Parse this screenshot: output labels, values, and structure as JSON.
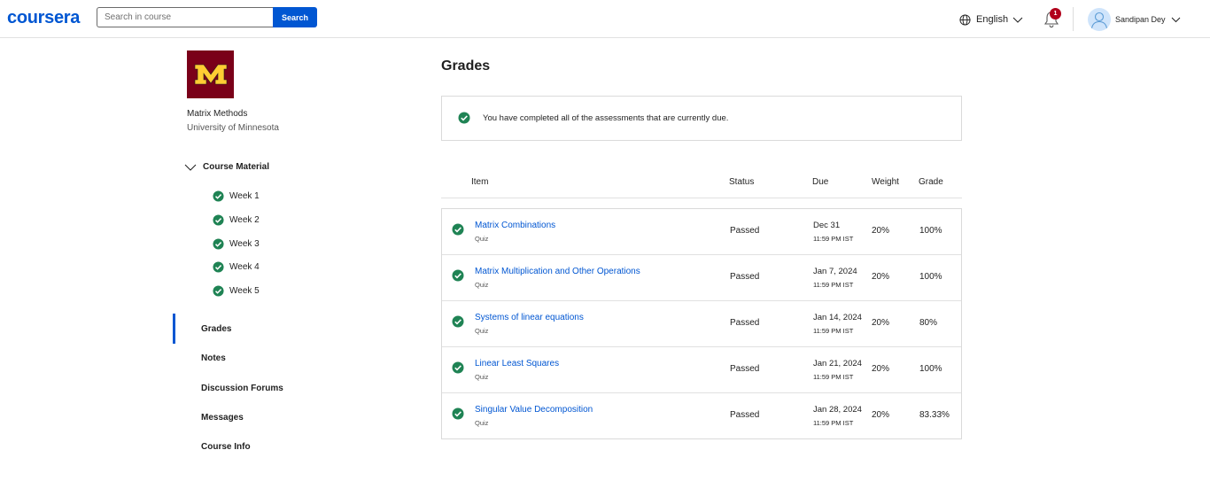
{
  "header": {
    "logo": "coursera",
    "search_placeholder": "Search in course",
    "search_button": "Search",
    "language": "English",
    "notification_count": "1",
    "user_name": "Sandipan Dey"
  },
  "sidebar": {
    "course_title": "Matrix Methods",
    "university": "University of Minnesota",
    "course_material_label": "Course Material",
    "weeks": [
      "Week 1",
      "Week 2",
      "Week 3",
      "Week 4",
      "Week 5"
    ],
    "nav": [
      "Grades",
      "Notes",
      "Discussion Forums",
      "Messages",
      "Course Info"
    ],
    "active_nav": "Grades"
  },
  "main": {
    "title": "Grades",
    "notice": "You have completed all of the assessments that are currently due.",
    "columns": [
      "Item",
      "Status",
      "Due",
      "Weight",
      "Grade"
    ],
    "rows": [
      {
        "name": "Matrix Combinations",
        "type": "Quiz",
        "status": "Passed",
        "due_date": "Dec 31",
        "due_time": "11:59 PM IST",
        "weight": "20%",
        "grade": "100%"
      },
      {
        "name": "Matrix Multiplication and Other Operations",
        "type": "Quiz",
        "status": "Passed",
        "due_date": "Jan 7, 2024",
        "due_time": "11:59 PM IST",
        "weight": "20%",
        "grade": "100%"
      },
      {
        "name": "Systems of linear equations",
        "type": "Quiz",
        "status": "Passed",
        "due_date": "Jan 14, 2024",
        "due_time": "11:59 PM IST",
        "weight": "20%",
        "grade": "80%"
      },
      {
        "name": "Linear Least Squares",
        "type": "Quiz",
        "status": "Passed",
        "due_date": "Jan 21, 2024",
        "due_time": "11:59 PM IST",
        "weight": "20%",
        "grade": "100%"
      },
      {
        "name": "Singular Value Decomposition",
        "type": "Quiz",
        "status": "Passed",
        "due_date": "Jan 28, 2024",
        "due_time": "11:59 PM IST",
        "weight": "20%",
        "grade": "83.33%"
      }
    ]
  },
  "colors": {
    "brand_blue": "#0056d2",
    "success_green": "#1f8354",
    "umn_maroon": "#7a0019",
    "umn_gold": "#ffcc33",
    "badge_red": "#b1001c"
  },
  "icons": {
    "globe": "globe-icon",
    "chevron": "chevron-down-icon",
    "bell": "bell-icon",
    "check": "check-circle-icon"
  }
}
